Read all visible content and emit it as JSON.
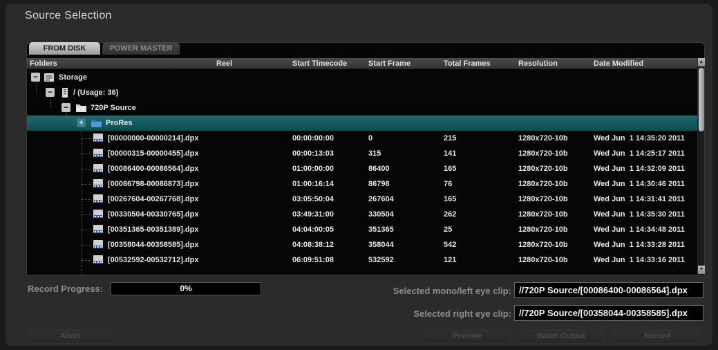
{
  "window": {
    "title": "Source Selection"
  },
  "tabs": [
    "FROM DISK",
    "POWER MASTER"
  ],
  "columns": [
    "Folders",
    "Reel",
    "Start Timecode",
    "Start Frame",
    "Total Frames",
    "Resolution",
    "Date Modified"
  ],
  "tree": {
    "storage": "Storage",
    "volume": "/ (Usage: 36)",
    "folder": "720P Source",
    "subfolder": "ProRes"
  },
  "files": [
    {
      "name": "[00000000-00000214].dpx",
      "reel": "",
      "start_timecode": "00:00:00:00",
      "start_frame": "0",
      "total_frames": "215",
      "resolution": "1280x720-10b",
      "date_modified": "Wed Jun  1 14:35:20 2011"
    },
    {
      "name": "[00000315-00000455].dpx",
      "reel": "",
      "start_timecode": "00:00:13:03",
      "start_frame": "315",
      "total_frames": "141",
      "resolution": "1280x720-10b",
      "date_modified": "Wed Jun  1 14:25:17 2011"
    },
    {
      "name": "[00086400-00086564].dpx",
      "reel": "",
      "start_timecode": "01:00:00:00",
      "start_frame": "86400",
      "total_frames": "165",
      "resolution": "1280x720-10b",
      "date_modified": "Wed Jun  1 14:32:09 2011"
    },
    {
      "name": "[00086798-00086873].dpx",
      "reel": "",
      "start_timecode": "01:00:16:14",
      "start_frame": "86798",
      "total_frames": "76",
      "resolution": "1280x720-10b",
      "date_modified": "Wed Jun  1 14:30:46 2011"
    },
    {
      "name": "[00267604-00267768].dpx",
      "reel": "",
      "start_timecode": "03:05:50:04",
      "start_frame": "267604",
      "total_frames": "165",
      "resolution": "1280x720-10b",
      "date_modified": "Wed Jun  1 14:31:41 2011"
    },
    {
      "name": "[00330504-00330765].dpx",
      "reel": "",
      "start_timecode": "03:49:31:00",
      "start_frame": "330504",
      "total_frames": "262",
      "resolution": "1280x720-10b",
      "date_modified": "Wed Jun  1 14:35:30 2011"
    },
    {
      "name": "[00351365-00351389].dpx",
      "reel": "",
      "start_timecode": "04:04:00:05",
      "start_frame": "351365",
      "total_frames": "25",
      "resolution": "1280x720-10b",
      "date_modified": "Wed Jun  1 14:34:48 2011"
    },
    {
      "name": "[00358044-00358585].dpx",
      "reel": "",
      "start_timecode": "04:08:38:12",
      "start_frame": "358044",
      "total_frames": "542",
      "resolution": "1280x720-10b",
      "date_modified": "Wed Jun  1 14:33:28 2011"
    },
    {
      "name": "[00532592-00532712].dpx",
      "reel": "",
      "start_timecode": "06:09:51:08",
      "start_frame": "532592",
      "total_frames": "121",
      "resolution": "1280x720-10b",
      "date_modified": "Wed Jun  1 14:33:16 2011"
    }
  ],
  "record_progress": {
    "label": "Record Progress:",
    "value": "0%"
  },
  "selected_mono": {
    "label": "Selected mono/left eye clip:",
    "value": "//720P Source/[00086400-00086564].dpx"
  },
  "selected_right": {
    "label": "Selected right eye clip:",
    "value": "//720P Source/[00358044-00358585].dpx"
  },
  "buttons": {
    "abort": "Abort",
    "preview": "Preview",
    "batch_output": "Batch Output",
    "record": "Record"
  },
  "icons": {
    "collapse": "−",
    "expand": "+",
    "scroll_up": "▲",
    "scroll_down": "▼"
  },
  "colors": {
    "selection": "#1d6c6c",
    "folder": "#3f8fc9"
  }
}
